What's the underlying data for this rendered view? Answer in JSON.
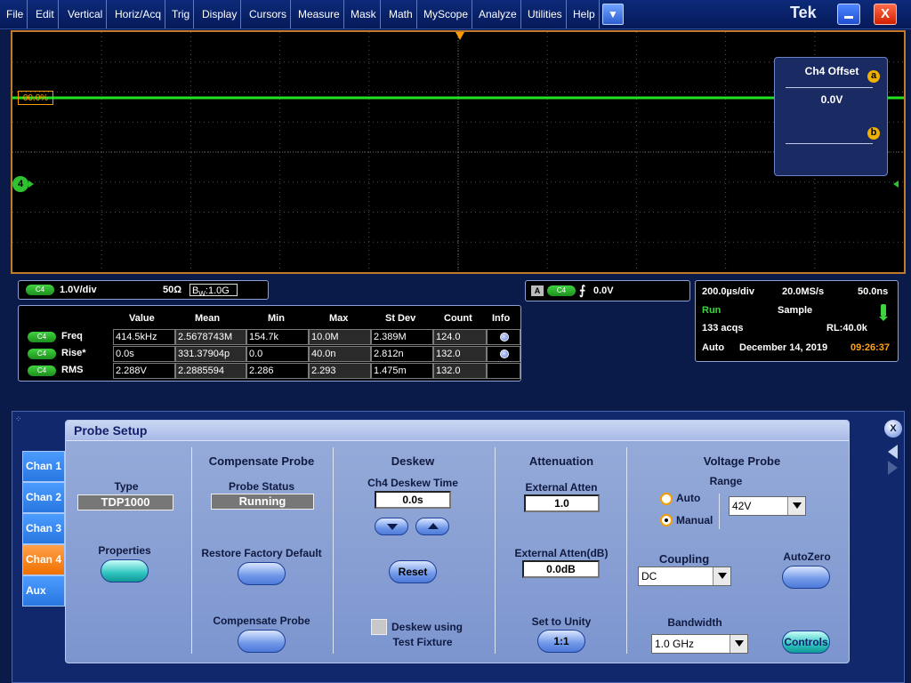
{
  "menu": {
    "items": [
      "File",
      "Edit",
      "Vertical",
      "Horiz/Acq",
      "Trig",
      "Display",
      "Cursors",
      "Measure",
      "Mask",
      "Math",
      "MyScope",
      "Analyze",
      "Utilities",
      "Help"
    ],
    "brand": "Tek",
    "close_label": "X"
  },
  "display": {
    "ref_label": "00.0%",
    "channel_marker": "4",
    "offset_box": {
      "title": "Ch4 Offset",
      "value": "0.0V",
      "knob_a": "a",
      "knob_b": "b"
    }
  },
  "channel_readout": {
    "badge": "C4",
    "scale": "1.0V/div",
    "termination": "50Ω",
    "bandwidth_prefix": "B",
    "bandwidth_sub": "W",
    "bandwidth": ":1.0G"
  },
  "trigger_readout": {
    "source_letter": "A",
    "badge": "C4",
    "slope": "⨍",
    "level": "0.0V"
  },
  "measurements": {
    "headers": [
      "Value",
      "Mean",
      "Min",
      "Max",
      "St Dev",
      "Count",
      "Info"
    ],
    "rows": [
      {
        "badge": "C4",
        "name": "Freq",
        "cells": [
          "414.5kHz",
          "2.5678743M",
          "154.7k",
          "10.0M",
          "2.389M",
          "124.0"
        ]
      },
      {
        "badge": "C4",
        "name": "Rise*",
        "cells": [
          "0.0s",
          "331.37904p",
          "0.0",
          "40.0n",
          "2.812n",
          "132.0"
        ]
      },
      {
        "badge": "C4",
        "name": "RMS",
        "cells": [
          "2.288V",
          "2.2885594",
          "2.286",
          "2.293",
          "1.475m",
          "132.0"
        ]
      }
    ]
  },
  "acquisition": {
    "horizontal_scale": "200.0µs/div",
    "sample_rate": "20.0MS/s",
    "resolution": "50.0ns",
    "run_state": "Run",
    "mode": "Sample",
    "acqs": "133 acqs",
    "record_length": "RL:40.0k",
    "trigger_mode": "Auto",
    "date": "December 14, 2019",
    "time": "09:26:37"
  },
  "probe_setup": {
    "title": "Probe Setup",
    "tabs": [
      "Chan 1",
      "Chan 2",
      "Chan 3",
      "Chan 4",
      "Aux"
    ],
    "active_tab": "Chan 4",
    "type_label": "Type",
    "type_value": "TDP1000",
    "properties_label": "Properties",
    "compensate": {
      "title": "Compensate Probe",
      "status_label": "Probe Status",
      "status_value": "Running",
      "restore_label": "Restore Factory Default",
      "compensate_label": "Compensate Probe"
    },
    "deskew": {
      "title": "Deskew",
      "time_label": "Ch4 Deskew Time",
      "time_value": "0.0s",
      "reset_label": "Reset",
      "fixture_label_1": "Deskew using",
      "fixture_label_2": "Test Fixture"
    },
    "attenuation": {
      "title": "Attenuation",
      "external_label": "External Atten",
      "external_value": "1.0",
      "external_db_label": "External Atten(dB)",
      "external_db_value": "0.0dB",
      "unity_label": "Set to Unity",
      "unity_button": "1:1"
    },
    "voltage_probe": {
      "title": "Voltage Probe",
      "range_label": "Range",
      "auto_label": "Auto",
      "manual_label": "Manual",
      "range_selection": "Manual",
      "range_value": "42V",
      "coupling_label": "Coupling",
      "coupling_value": "DC",
      "autozero_label": "AutoZero",
      "bandwidth_label": "Bandwidth",
      "bandwidth_value": "1.0 GHz",
      "controls_label": "Controls"
    },
    "close_label": "X"
  },
  "colors": {
    "trace": "#22e022",
    "accent_orange": "#ff9a00",
    "active_tab": "#f07000",
    "time_text": "#ffa21a",
    "run_text": "#3fd33f"
  }
}
